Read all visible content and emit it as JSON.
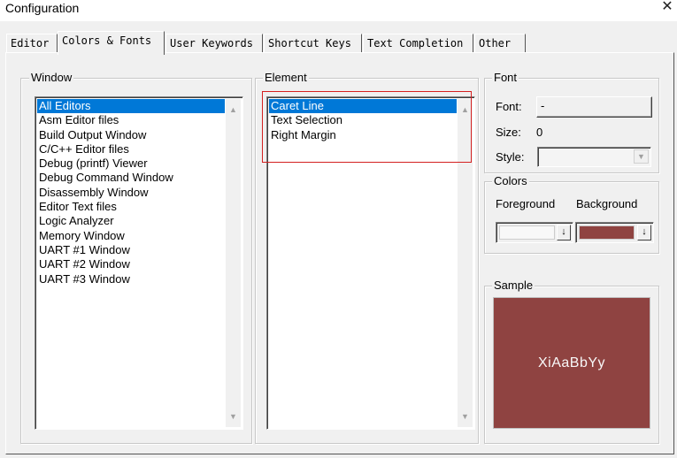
{
  "window": {
    "title": "Configuration"
  },
  "tabs": [
    {
      "label": "Editor"
    },
    {
      "label": "Colors & Fonts"
    },
    {
      "label": "User Keywords"
    },
    {
      "label": "Shortcut Keys"
    },
    {
      "label": "Text Completion"
    },
    {
      "label": "Other"
    }
  ],
  "active_tab": "Colors & Fonts",
  "window_group": {
    "legend": "Window",
    "items": [
      "All Editors",
      "Asm Editor files",
      "Build Output Window",
      "C/C++ Editor files",
      "Debug (printf) Viewer",
      "Debug Command Window",
      "Disassembly Window",
      "Editor Text files",
      "Logic Analyzer",
      "Memory Window",
      "UART #1 Window",
      "UART #2 Window",
      "UART #3 Window"
    ],
    "selected": "All Editors"
  },
  "element_group": {
    "legend": "Element",
    "items": [
      "Caret Line",
      "Text Selection",
      "Right Margin"
    ],
    "selected": "Caret Line"
  },
  "font_group": {
    "legend": "Font",
    "font_label": "Font:",
    "font_value": "-",
    "size_label": "Size:",
    "size_value": "0",
    "style_label": "Style:",
    "style_value": ""
  },
  "colors_group": {
    "legend": "Colors",
    "foreground_label": "Foreground",
    "background_label": "Background",
    "foreground_color": "#f8f8f8",
    "background_color": "#8f4341"
  },
  "sample_group": {
    "legend": "Sample",
    "text": "XiAaBbYy",
    "bg_color": "#8f4341",
    "fg_color": "#f8f8f8"
  },
  "icons": {
    "close": "close-icon",
    "scroll_up": "scroll-up-arrow-icon",
    "scroll_down": "scroll-down-arrow-icon",
    "dropdown": "dropdown-arrow-icon"
  },
  "highlight_color": "#d42020"
}
